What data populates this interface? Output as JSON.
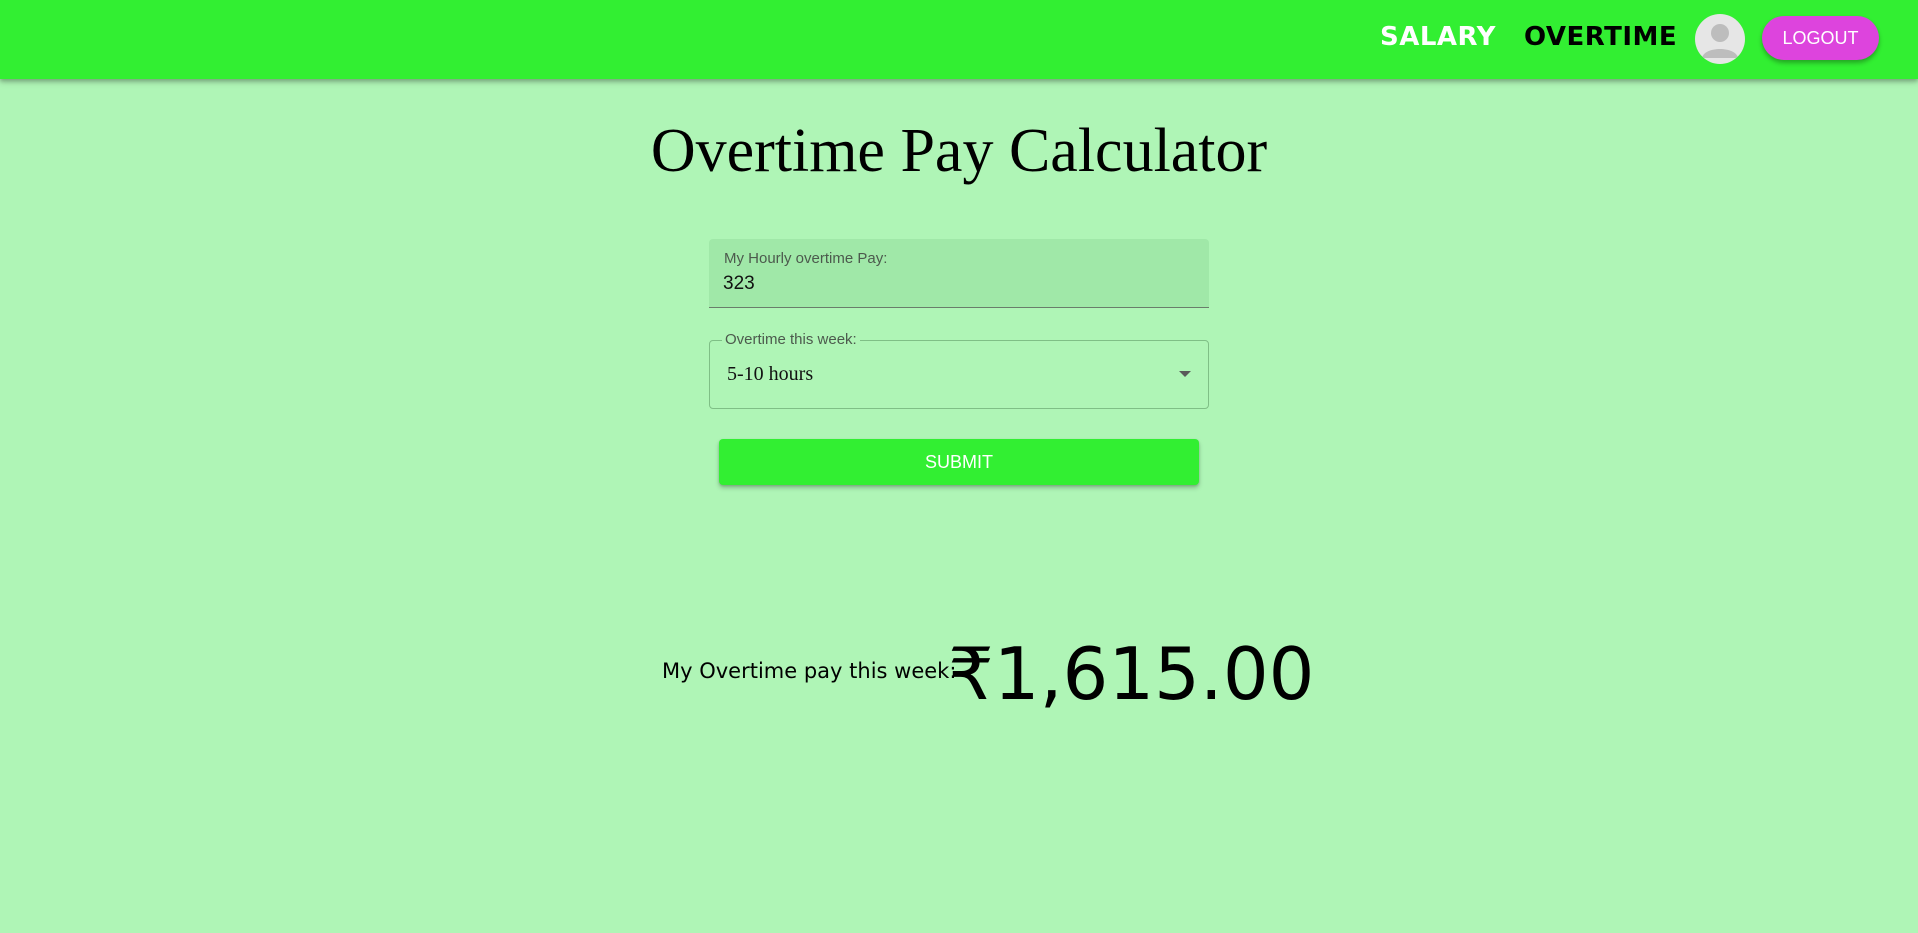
{
  "nav": {
    "salary_label": "SALARY",
    "overtime_label": "OVERTIME",
    "avatar_icon": "user-avatar-icon",
    "logout_label": "LOGOUT"
  },
  "page": {
    "title": "Overtime Pay Calculator"
  },
  "form": {
    "hourly_pay_label": "My Hourly overtime Pay:",
    "hourly_pay_value": "323",
    "overtime_label": "Overtime this week:",
    "overtime_selected": "5-10 hours",
    "submit_label": "SUBMIT"
  },
  "result": {
    "label": "My Overtime pay this week:",
    "value": "₹1,615.00"
  },
  "colors": {
    "background": "#aff5b6",
    "topbar": "#32ef32",
    "logout": "#dd44dd",
    "submit": "#32ef32"
  }
}
